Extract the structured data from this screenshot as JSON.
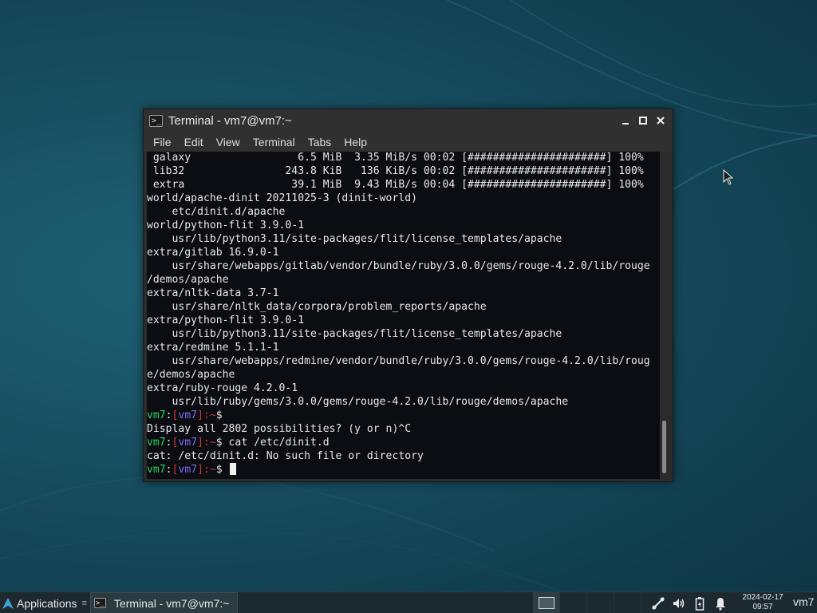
{
  "window": {
    "title": "Terminal - vm7@vm7:~",
    "menu": [
      "File",
      "Edit",
      "View",
      "Terminal",
      "Tabs",
      "Help"
    ]
  },
  "terminal": {
    "lines": [
      " galaxy                 6.5 MiB  3.35 MiB/s 00:02 [######################] 100%",
      " lib32                243.8 KiB   136 KiB/s 00:02 [######################] 100%",
      " extra                 39.1 MiB  9.43 MiB/s 00:04 [######################] 100%",
      "world/apache-dinit 20211025-3 (dinit-world)",
      "    etc/dinit.d/apache",
      "world/python-flit 3.9.0-1",
      "    usr/lib/python3.11/site-packages/flit/license_templates/apache",
      "extra/gitlab 16.9.0-1",
      "    usr/share/webapps/gitlab/vendor/bundle/ruby/3.0.0/gems/rouge-4.2.0/lib/rouge",
      "/demos/apache",
      "extra/nltk-data 3.7-1",
      "    usr/share/nltk_data/corpora/problem_reports/apache",
      "extra/python-flit 3.9.0-1",
      "    usr/lib/python3.11/site-packages/flit/license_templates/apache",
      "extra/redmine 5.1.1-1",
      "    usr/share/webapps/redmine/vendor/bundle/ruby/3.0.0/gems/rouge-4.2.0/lib/roug",
      "e/demos/apache",
      "extra/ruby-rouge 4.2.0-1",
      "    usr/lib/ruby/gems/3.0.0/gems/rouge-4.2.0/lib/rouge/demos/apache"
    ],
    "prompt": {
      "host": "vm7",
      "colon": ":",
      "lbr": "[",
      "user": "vm7",
      "rbr": "]",
      "path": ":~",
      "dollar": "$ "
    },
    "session": [
      {
        "type": "prompt",
        "command": ""
      },
      {
        "type": "output",
        "text": "Display all 2802 possibilities? (y or n)^C"
      },
      {
        "type": "prompt",
        "command": "cat /etc/dinit.d"
      },
      {
        "type": "output",
        "text": "cat: /etc/dinit.d: No such file or directory"
      },
      {
        "type": "prompt",
        "command": "",
        "cursor": true
      }
    ]
  },
  "taskbar": {
    "applications_label": "Applications",
    "task_label": "Terminal - vm7@vm7:~",
    "clock_date": "2024-02-17",
    "clock_time": "09:57",
    "user": "vm7"
  },
  "colors": {
    "prompt_host": "#2fd160",
    "prompt_bracket": "#d03838",
    "prompt_user": "#7a6cf0",
    "terminal_bg": "#0b0d12"
  },
  "icons": {
    "terminal": "terminal-icon",
    "minimize": "minimize-icon",
    "maximize": "maximize-icon",
    "close": "close-icon",
    "network": "network-icon",
    "volume": "volume-icon",
    "battery": "battery-icon",
    "notifications": "bell-icon"
  }
}
